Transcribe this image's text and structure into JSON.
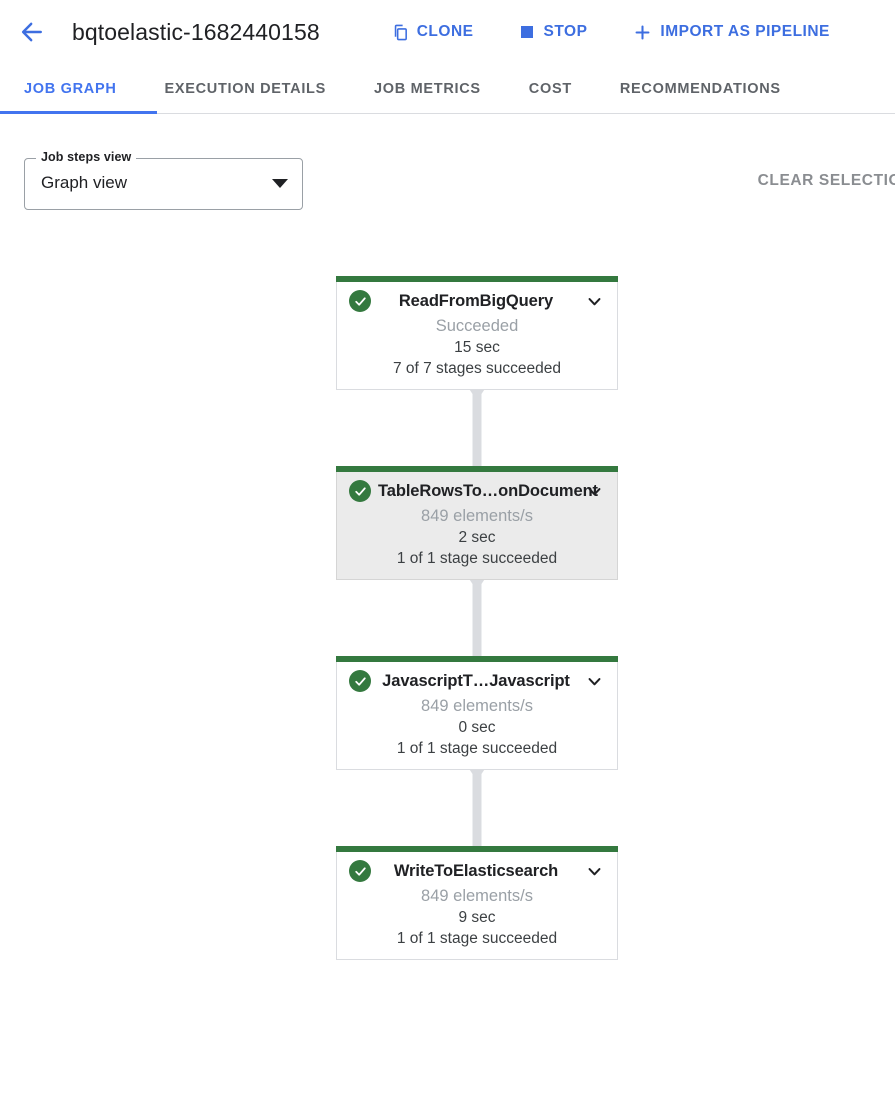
{
  "header": {
    "back_icon": "arrow-left-icon",
    "title": "bqtoelastic-1682440158",
    "actions": [
      {
        "label": "CLONE",
        "icon": "clone-icon"
      },
      {
        "label": "STOP",
        "icon": "stop-square-icon"
      },
      {
        "label": "IMPORT AS PIPELINE",
        "icon": "plus-icon"
      }
    ]
  },
  "tabs": [
    {
      "label": "JOB GRAPH",
      "active": true
    },
    {
      "label": "EXECUTION DETAILS",
      "active": false
    },
    {
      "label": "JOB METRICS",
      "active": false
    },
    {
      "label": "COST",
      "active": false
    },
    {
      "label": "RECOMMENDATIONS",
      "active": false
    }
  ],
  "controls": {
    "select_label": "Job steps view",
    "select_value": "Graph view",
    "clear_selection_label": "CLEAR SELECTION"
  },
  "graph": {
    "nodes": [
      {
        "title": "ReadFromBigQuery",
        "status_icon": "check-circle-icon",
        "subtitle": "Succeeded",
        "duration": "15 sec",
        "stages": "7 of 7 stages succeeded",
        "selected": false,
        "chevron_icon": "chevron-down-icon"
      },
      {
        "title": "TableRowsTo…onDocument",
        "status_icon": "check-circle-icon",
        "subtitle": "849 elements/s",
        "duration": "2 sec",
        "stages": "1 of 1 stage succeeded",
        "selected": true,
        "chevron_icon": "chevron-down-icon"
      },
      {
        "title": "JavascriptT…Javascript",
        "status_icon": "check-circle-icon",
        "subtitle": "849 elements/s",
        "duration": "0 sec",
        "stages": "1 of 1 stage succeeded",
        "selected": false,
        "chevron_icon": "chevron-down-icon"
      },
      {
        "title": "WriteToElasticsearch",
        "status_icon": "check-circle-icon",
        "subtitle": "849 elements/s",
        "duration": "9 sec",
        "stages": "1 of 1 stage succeeded",
        "selected": false,
        "chevron_icon": "chevron-down-icon"
      }
    ]
  },
  "colors": {
    "accent_blue": "#4274ef",
    "action_blue": "#3d6ee0",
    "success_green": "#34793f",
    "muted_gray": "#9aa0a6",
    "selected_bg": "#ebebeb",
    "connector_gray": "#dadce0"
  }
}
